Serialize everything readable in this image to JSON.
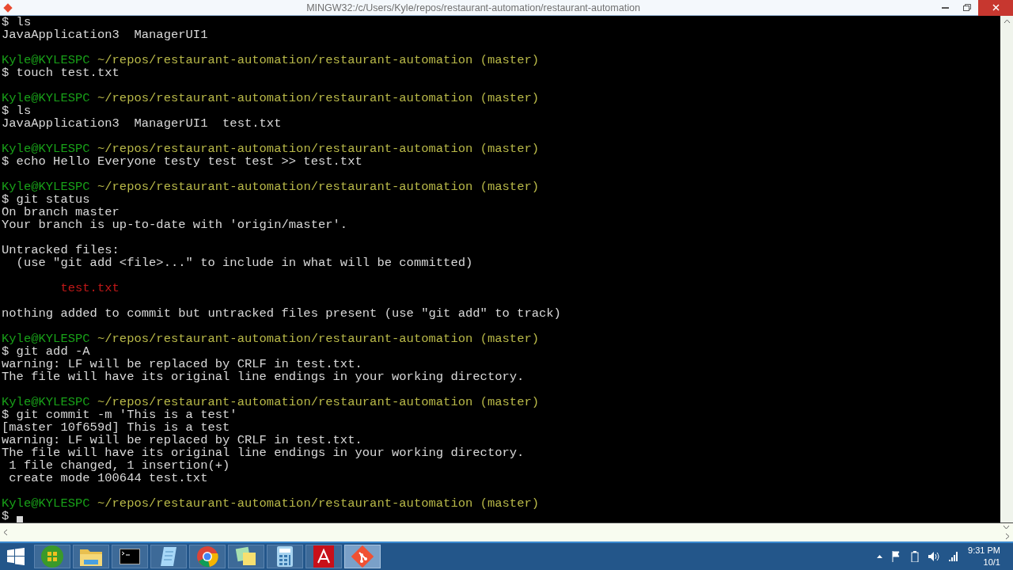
{
  "window": {
    "title": "MINGW32:/c/Users/Kyle/repos/restaurant-automation/restaurant-automation"
  },
  "terminal": {
    "lines": [
      {
        "kind": "text",
        "text": "$ ls"
      },
      {
        "kind": "text",
        "text": "JavaApplication3  ManagerUI1"
      },
      {
        "kind": "blank"
      },
      {
        "kind": "prompt",
        "user": "Kyle@KYLESPC",
        "path": "~/repos/restaurant-automation/restaurant-automation",
        "branch": "(master)"
      },
      {
        "kind": "text",
        "text": "$ touch test.txt"
      },
      {
        "kind": "blank"
      },
      {
        "kind": "prompt",
        "user": "Kyle@KYLESPC",
        "path": "~/repos/restaurant-automation/restaurant-automation",
        "branch": "(master)"
      },
      {
        "kind": "text",
        "text": "$ ls"
      },
      {
        "kind": "text",
        "text": "JavaApplication3  ManagerUI1  test.txt"
      },
      {
        "kind": "blank"
      },
      {
        "kind": "prompt",
        "user": "Kyle@KYLESPC",
        "path": "~/repos/restaurant-automation/restaurant-automation",
        "branch": "(master)"
      },
      {
        "kind": "text",
        "text": "$ echo Hello Everyone testy test test >> test.txt"
      },
      {
        "kind": "blank"
      },
      {
        "kind": "prompt",
        "user": "Kyle@KYLESPC",
        "path": "~/repos/restaurant-automation/restaurant-automation",
        "branch": "(master)"
      },
      {
        "kind": "text",
        "text": "$ git status"
      },
      {
        "kind": "text",
        "text": "On branch master"
      },
      {
        "kind": "text",
        "text": "Your branch is up-to-date with 'origin/master'."
      },
      {
        "kind": "blank"
      },
      {
        "kind": "text",
        "text": "Untracked files:"
      },
      {
        "kind": "text",
        "text": "  (use \"git add <file>...\" to include in what will be committed)"
      },
      {
        "kind": "blank"
      },
      {
        "kind": "untracked",
        "text": "        test.txt"
      },
      {
        "kind": "blank"
      },
      {
        "kind": "text",
        "text": "nothing added to commit but untracked files present (use \"git add\" to track)"
      },
      {
        "kind": "blank"
      },
      {
        "kind": "prompt",
        "user": "Kyle@KYLESPC",
        "path": "~/repos/restaurant-automation/restaurant-automation",
        "branch": "(master)"
      },
      {
        "kind": "text",
        "text": "$ git add -A"
      },
      {
        "kind": "text",
        "text": "warning: LF will be replaced by CRLF in test.txt."
      },
      {
        "kind": "text",
        "text": "The file will have its original line endings in your working directory."
      },
      {
        "kind": "blank"
      },
      {
        "kind": "prompt",
        "user": "Kyle@KYLESPC",
        "path": "~/repos/restaurant-automation/restaurant-automation",
        "branch": "(master)"
      },
      {
        "kind": "text",
        "text": "$ git commit -m 'This is a test'"
      },
      {
        "kind": "text",
        "text": "[master 10f659d] This is a test"
      },
      {
        "kind": "text",
        "text": "warning: LF will be replaced by CRLF in test.txt."
      },
      {
        "kind": "text",
        "text": "The file will have its original line endings in your working directory."
      },
      {
        "kind": "text",
        "text": " 1 file changed, 1 insertion(+)"
      },
      {
        "kind": "text",
        "text": " create mode 100644 test.txt"
      },
      {
        "kind": "blank"
      },
      {
        "kind": "prompt",
        "user": "Kyle@KYLESPC",
        "path": "~/repos/restaurant-automation/restaurant-automation",
        "branch": "(master)"
      },
      {
        "kind": "cursor",
        "text": "$"
      }
    ]
  },
  "taskbar": {
    "apps": [
      {
        "kind": "media",
        "selected": false
      },
      {
        "kind": "folder",
        "selected": false
      },
      {
        "kind": "console",
        "selected": false
      },
      {
        "kind": "notepad",
        "selected": false
      },
      {
        "kind": "chrome",
        "selected": false
      },
      {
        "kind": "notes",
        "selected": false
      },
      {
        "kind": "calculator",
        "selected": false
      },
      {
        "kind": "pdf",
        "selected": false
      },
      {
        "kind": "git",
        "selected": true
      }
    ],
    "clock": {
      "time": "9:31 PM",
      "date": "10/1"
    }
  }
}
